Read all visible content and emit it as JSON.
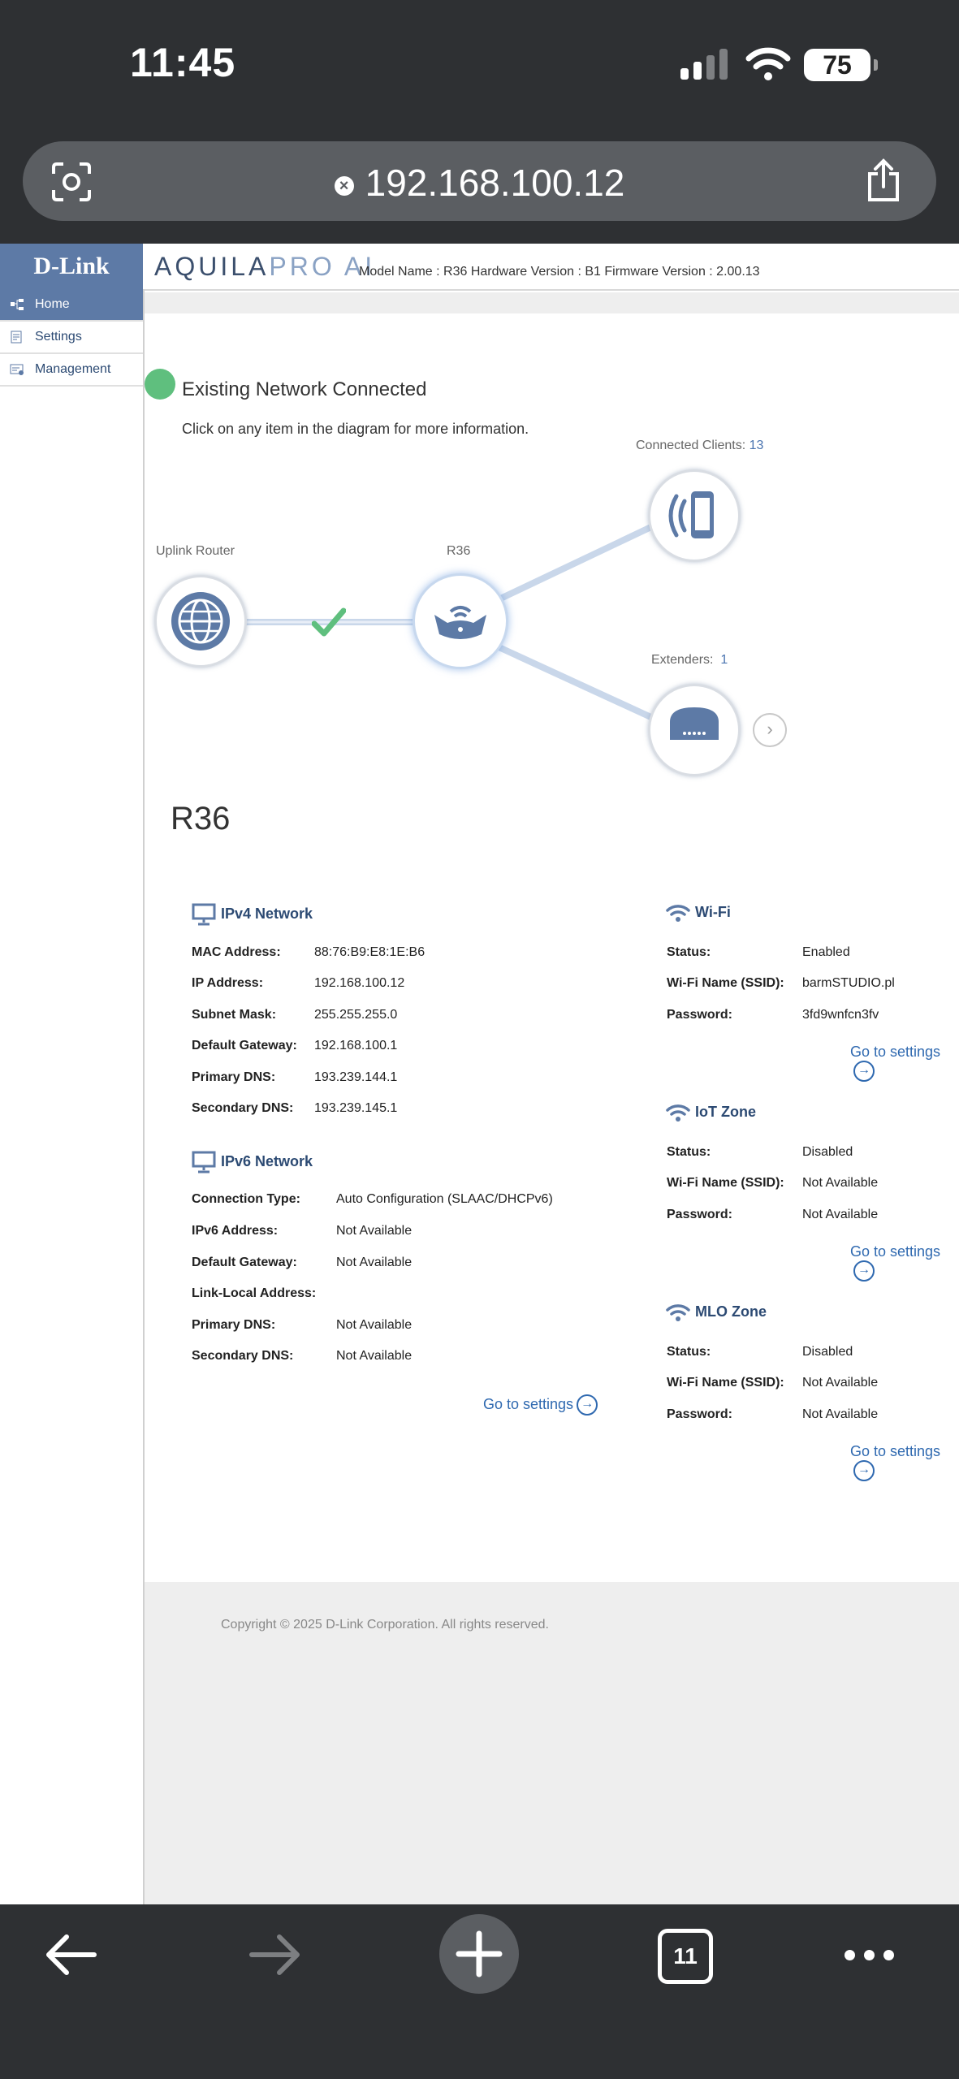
{
  "status_bar": {
    "time": "11:45",
    "battery": "75"
  },
  "browser": {
    "url": "192.168.100.12",
    "tab_count": "11"
  },
  "header": {
    "logo": "D-Link",
    "brand_main": "AQUILA",
    "brand_pro": "PRO AI",
    "model_info": "Model Name : R36 Hardware Version : B1 Firmware Version : 2.00.13"
  },
  "sidebar": {
    "items": [
      {
        "label": "Home",
        "active": true
      },
      {
        "label": "Settings",
        "active": false
      },
      {
        "label": "Management",
        "active": false
      }
    ]
  },
  "diagram": {
    "status_text": "Existing Network Connected",
    "hint": "Click on any item in the diagram for more information.",
    "uplink_label": "Uplink Router",
    "device_label": "R36",
    "clients_label": "Connected Clients:",
    "clients_count": "13",
    "extenders_label": "Extenders:",
    "extenders_count": "1"
  },
  "device_title": "R36",
  "ipv4": {
    "title": "IPv4 Network",
    "rows": [
      {
        "label": "MAC Address:",
        "value": "88:76:B9:E8:1E:B6"
      },
      {
        "label": "IP Address:",
        "value": "192.168.100.12"
      },
      {
        "label": "Subnet Mask:",
        "value": "255.255.255.0"
      },
      {
        "label": "Default Gateway:",
        "value": "192.168.100.1"
      },
      {
        "label": "Primary DNS:",
        "value": "193.239.144.1"
      },
      {
        "label": "Secondary DNS:",
        "value": "193.239.145.1"
      }
    ]
  },
  "ipv6": {
    "title": "IPv6 Network",
    "rows": [
      {
        "label": "Connection Type:",
        "value": "Auto Configuration (SLAAC/DHCPv6)"
      },
      {
        "label": "IPv6 Address:",
        "value": "Not Available"
      },
      {
        "label": "Default Gateway:",
        "value": "Not Available"
      },
      {
        "label": "Link-Local Address:",
        "value": ""
      },
      {
        "label": "Primary DNS:",
        "value": "Not Available"
      },
      {
        "label": "Secondary DNS:",
        "value": "Not Available"
      }
    ],
    "goto": "Go to settings"
  },
  "wifi": {
    "title": "Wi-Fi",
    "rows": [
      {
        "label": "Status:",
        "value": "Enabled"
      },
      {
        "label": "Wi-Fi Name (SSID):",
        "value": "barmSTUDIO.pl"
      },
      {
        "label": "Password:",
        "value": "3fd9wnfcn3fv"
      }
    ],
    "goto": "Go to settings"
  },
  "iot": {
    "title": "IoT Zone",
    "rows": [
      {
        "label": "Status:",
        "value": "Disabled"
      },
      {
        "label": "Wi-Fi Name (SSID):",
        "value": "Not Available"
      },
      {
        "label": "Password:",
        "value": "Not Available"
      }
    ],
    "goto": "Go to settings"
  },
  "mlo": {
    "title": "MLO Zone",
    "rows": [
      {
        "label": "Status:",
        "value": "Disabled"
      },
      {
        "label": "Wi-Fi Name (SSID):",
        "value": "Not Available"
      },
      {
        "label": "Password:",
        "value": "Not Available"
      }
    ],
    "goto": "Go to settings"
  },
  "footer": {
    "copyright": "Copyright © 2025 D-Link Corporation. All rights reserved."
  }
}
